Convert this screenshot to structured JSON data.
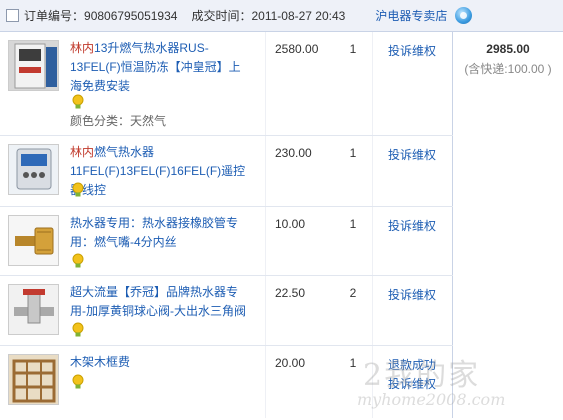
{
  "order": {
    "number_label": "订单编号：",
    "number": "90806795051934",
    "time_label": "成交时间：",
    "time": "2011-08-27 20:43",
    "shop": "沪电器专卖店"
  },
  "total": {
    "amount": "2985.00",
    "shipping": "(含快递:100.00 )"
  },
  "items": [
    {
      "brand": "林内",
      "title": "13升燃气热水器RUS-13FEL(F)恒温防冻【冲皇冠】上海免费安装",
      "attr": "颜色分类：天然气",
      "price": "2580.00",
      "qty": "1",
      "action": "投诉维权"
    },
    {
      "brand": "林内",
      "title": "燃气热水器11FEL(F)13FEL(F)16FEL(F)遥控器线控",
      "price": "230.00",
      "qty": "1",
      "action": "投诉维权"
    },
    {
      "title": "热水器专用：热水器接橡胶管专用：燃气嘴-4分内丝",
      "price": "10.00",
      "qty": "1",
      "action": "投诉维权"
    },
    {
      "title": "超大流量【乔冠】品牌热水器专用-加厚黄铜球心阀-大出水三角阀",
      "price": "22.50",
      "qty": "2",
      "action": "投诉维权"
    },
    {
      "title": "木架木框费",
      "price": "20.00",
      "qty": "1",
      "status": "退款成功",
      "action": "投诉维权"
    }
  ],
  "watermark": {
    "main": "2我的家",
    "sub": "myhome2008.com"
  },
  "icons": [
    "checkbox",
    "wangwang-chat-icon",
    "lightbulb-icon",
    "water-heater-thumb",
    "remote-thumb",
    "brass-fitting-thumb",
    "valve-thumb",
    "wooden-crate-thumb"
  ],
  "colors": {
    "link": "#1d5db3",
    "brand": "#c0392b",
    "header_bg": "#eef1f8",
    "border": "#c9d3e6"
  }
}
